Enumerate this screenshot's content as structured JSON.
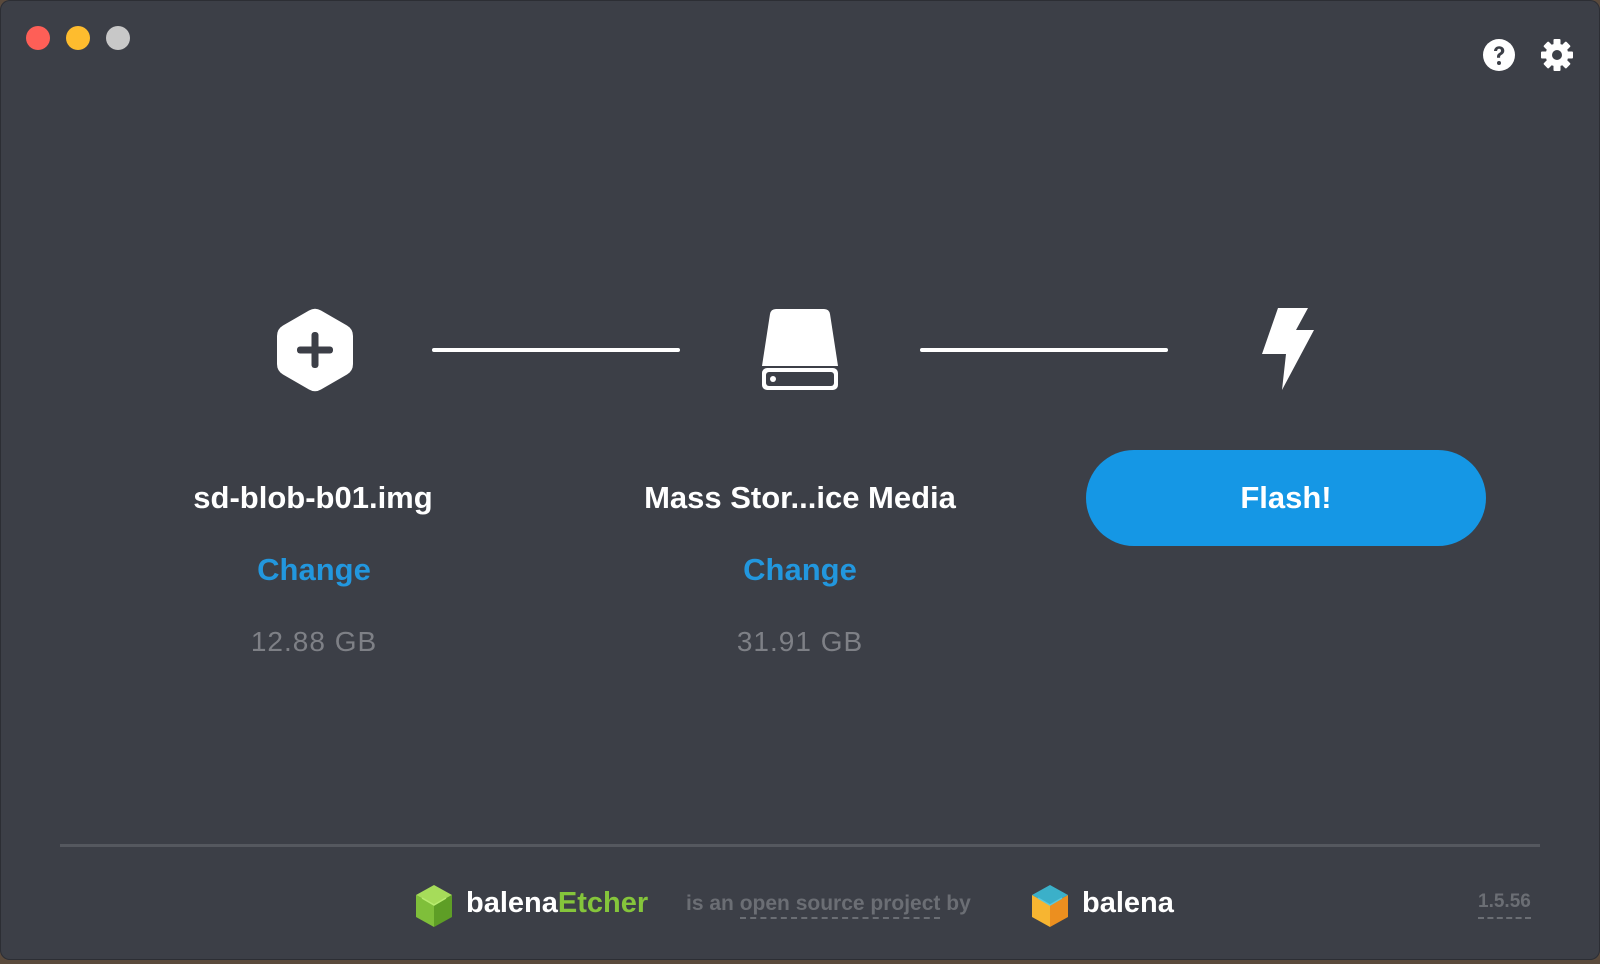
{
  "window": {
    "controls": [
      "close",
      "minimize",
      "zoom"
    ]
  },
  "topbar": {
    "help_icon": "question-circle-icon",
    "settings_icon": "gear-icon"
  },
  "steps": {
    "image": {
      "icon": "hexagon-plus-icon",
      "name": "sd-blob-b01.img",
      "change_label": "Change",
      "size": "12.88 GB"
    },
    "drive": {
      "icon": "hard-drive-icon",
      "name": "Mass Stor...ice Media",
      "change_label": "Change",
      "size": "31.91 GB"
    },
    "flash": {
      "icon": "lightning-bolt-icon",
      "button_label": "Flash!"
    }
  },
  "footer": {
    "app_name_prefix": "balena",
    "app_name_suffix": "Etcher",
    "tagline_part1": "is an ",
    "tagline_link": "open source project",
    "tagline_part2": " by",
    "company_name": "balena",
    "version": "1.5.56"
  },
  "colors": {
    "background": "#3c3f47",
    "accent_blue": "#1597e5",
    "link_blue": "#2297de",
    "etcher_green": "#85c53b",
    "muted_text": "#7e8086"
  }
}
